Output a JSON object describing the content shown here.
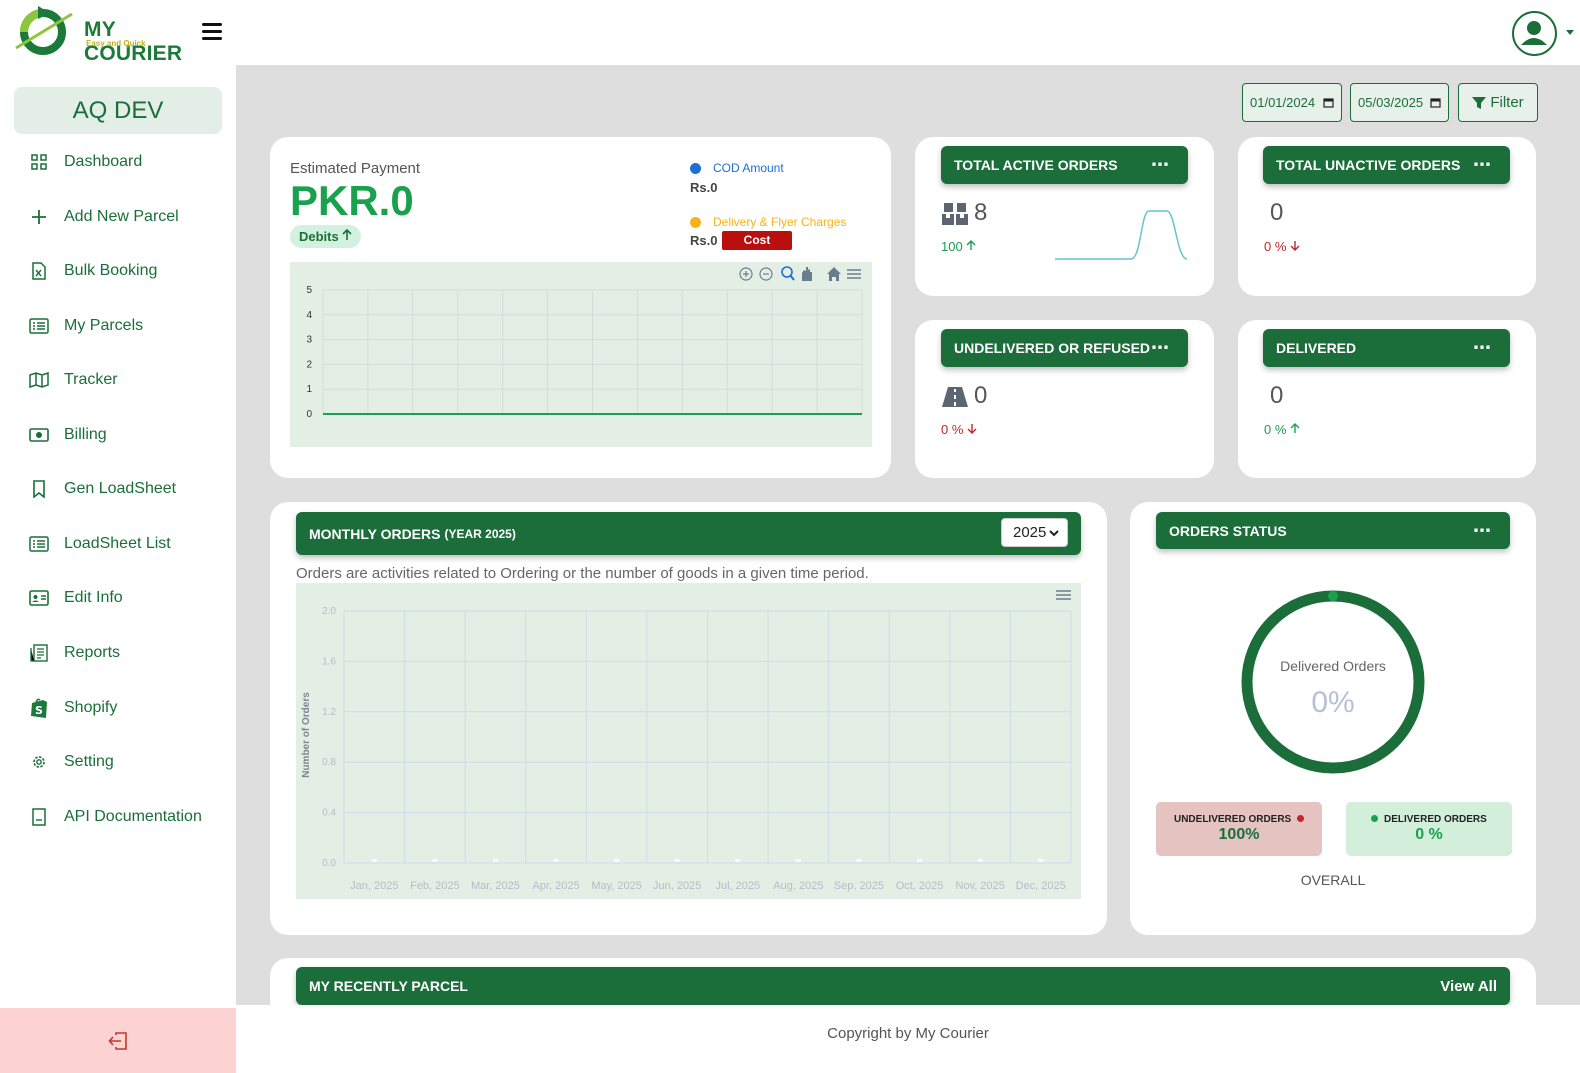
{
  "brand": {
    "name": "MY COURIER",
    "tagline": "Easy and Quick"
  },
  "sidebar": {
    "account": "AQ DEV",
    "items": [
      {
        "label": "Dashboard",
        "icon": "grid-icon"
      },
      {
        "label": "Add New Parcel",
        "icon": "plus-icon"
      },
      {
        "label": "Bulk Booking",
        "icon": "excel-file-icon"
      },
      {
        "label": "My Parcels",
        "icon": "list-icon"
      },
      {
        "label": "Tracker",
        "icon": "map-icon"
      },
      {
        "label": "Billing",
        "icon": "cash-icon"
      },
      {
        "label": "Gen LoadSheet",
        "icon": "bookmark-icon"
      },
      {
        "label": "LoadSheet List",
        "icon": "list-icon"
      },
      {
        "label": "Edit Info",
        "icon": "id-card-icon"
      },
      {
        "label": "Reports",
        "icon": "report-icon"
      },
      {
        "label": "Shopify",
        "icon": "shopify-icon"
      },
      {
        "label": "Setting",
        "icon": "gear-icon"
      },
      {
        "label": "API Documentation",
        "icon": "document-icon"
      }
    ]
  },
  "filters": {
    "date_from": "01/01/2024",
    "date_to": "05/03/2025",
    "filter_label": "Filter"
  },
  "payment": {
    "title": "Estimated Payment",
    "value": "PKR.0",
    "badge": "Debits",
    "cod_label": "COD Amount",
    "cod_value": "Rs.0",
    "delivery_label": "Delivery & Flyer Charges",
    "delivery_value": "Rs.0",
    "cost_label": "Cost",
    "colors": {
      "cod": "#1d6fd6",
      "delivery": "#f5b21c"
    }
  },
  "stats": {
    "total_active": {
      "title": "TOTAL ACTIVE ORDERS",
      "value": "8",
      "pct": "100",
      "trend": "up"
    },
    "total_unactive": {
      "title": "TOTAL UNACTIVE ORDERS",
      "value": "0",
      "pct": "0 %",
      "trend": "down"
    },
    "undelivered": {
      "title": "UNDELIVERED OR REFUSED",
      "value": "0",
      "pct": "0 %",
      "trend": "down"
    },
    "delivered": {
      "title": "DELIVERED",
      "value": "0",
      "pct": "0 %",
      "trend": "up"
    }
  },
  "monthly": {
    "title": "MONTHLY ORDERS",
    "title_suffix": "(YEAR 2025)",
    "year": "2025",
    "subtitle": "Orders are activities related to Ordering or the number of goods in a given time period."
  },
  "orders_status": {
    "title": "ORDERS STATUS",
    "donut_label": "Delivered Orders",
    "donut_value": "0%",
    "undelivered_label": "UNDELIVERED ORDERS",
    "undelivered_value": "100%",
    "delivered_label": "DELIVERED ORDERS",
    "delivered_value": "0 %",
    "overall": "OVERALL"
  },
  "recent": {
    "title": "MY RECENTLY PARCEL",
    "view_all": "View All"
  },
  "footer": {
    "text": "Copyright by My Courier"
  },
  "chart_data": [
    {
      "type": "line",
      "title": "",
      "x": [
        1,
        2,
        3,
        4,
        5,
        6,
        7,
        8,
        9,
        10,
        11,
        12
      ],
      "series": [
        {
          "values": [
            0,
            0,
            0,
            0,
            0,
            0,
            0,
            0,
            0,
            0,
            0,
            0
          ]
        }
      ],
      "ylim": [
        0,
        5
      ],
      "yticks": [
        0,
        1,
        2,
        3,
        4,
        5
      ],
      "grid": true,
      "toolbar": [
        "zoom-in-icon",
        "zoom-out-icon",
        "zoom-icon",
        "pan-icon",
        "home-icon",
        "menu-icon"
      ]
    },
    {
      "type": "bar",
      "title": "MONTHLY ORDERS (YEAR 2025)",
      "categories": [
        "Jan, 2025",
        "Feb, 2025",
        "Mar, 2025",
        "Apr, 2025",
        "May, 2025",
        "Jun, 2025",
        "Jul, 2025",
        "Aug, 2025",
        "Sep, 2025",
        "Oct, 2025",
        "Nov, 2025",
        "Dec, 2025"
      ],
      "values": [
        0,
        0,
        0,
        0,
        0,
        0,
        0,
        0,
        0,
        0,
        0,
        0
      ],
      "ylabel": "Number of Orders",
      "xlabel": "",
      "ylim": [
        0,
        2.0
      ],
      "yticks": [
        "0.0",
        "0.4",
        "0.8",
        "1.2",
        "1.6",
        "2.0"
      ],
      "grid": true
    },
    {
      "type": "pie",
      "title": "Delivered Orders",
      "categories": [
        "Delivered Orders",
        "Undelivered Orders"
      ],
      "values": [
        0,
        100
      ]
    }
  ]
}
